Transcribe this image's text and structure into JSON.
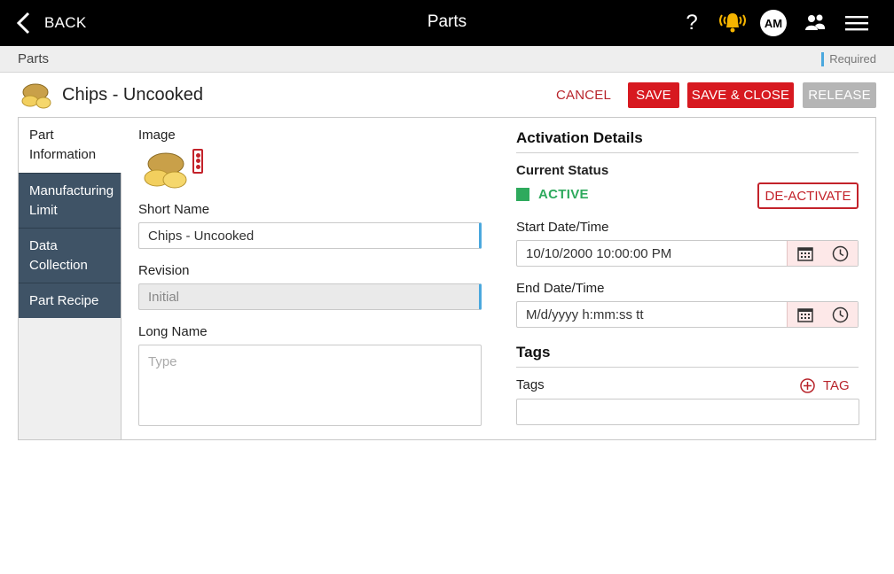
{
  "topbar": {
    "back_label": "BACK",
    "title": "Parts",
    "help_label": "?",
    "avatar_initials": "AM"
  },
  "breadcrumb": {
    "current": "Parts",
    "required_label": "Required"
  },
  "header": {
    "part_name": "Chips - Uncooked",
    "cancel_label": "CANCEL",
    "save_label": "SAVE",
    "save_close_label": "SAVE & CLOSE",
    "release_label": "RELEASE"
  },
  "sidebar": {
    "items": [
      {
        "label": "Part Information"
      },
      {
        "label": "Manufacturing Limit"
      },
      {
        "label": "Data Collection"
      },
      {
        "label": "Part Recipe"
      }
    ]
  },
  "form": {
    "image_label": "Image",
    "short_name_label": "Short Name",
    "short_name_value": "Chips - Uncooked",
    "revision_label": "Revision",
    "revision_value": "Initial",
    "long_name_label": "Long Name",
    "long_name_placeholder": "Type"
  },
  "activation": {
    "title": "Activation Details",
    "current_status_label": "Current Status",
    "status_value": "ACTIVE",
    "deactivate_label": "DE-ACTIVATE",
    "start_label": "Start Date/Time",
    "start_value": "10/10/2000 10:00:00 PM",
    "end_label": "End Date/Time",
    "end_placeholder": "M/d/yyyy h:mm:ss tt"
  },
  "tags": {
    "title": "Tags",
    "label": "Tags",
    "add_label": "TAG"
  },
  "colors": {
    "accent_red": "#d71920",
    "nav_dark": "#3f5366",
    "active_green": "#2eaa5d",
    "required_blue": "#4ba8de"
  }
}
